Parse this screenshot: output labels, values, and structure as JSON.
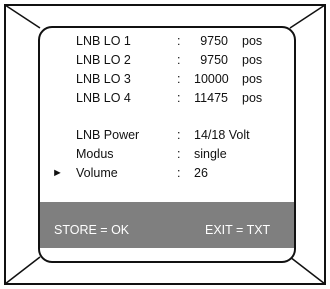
{
  "menu": {
    "rows": [
      {
        "label": "LNB LO 1",
        "colon": ":",
        "value": "9750",
        "unit": "pos"
      },
      {
        "label": "LNB LO 2",
        "colon": ":",
        "value": "9750",
        "unit": "pos"
      },
      {
        "label": "LNB LO 3",
        "colon": ":",
        "value": "10000",
        "unit": "pos"
      },
      {
        "label": "LNB LO 4",
        "colon": ":",
        "value": "11475",
        "unit": "pos"
      }
    ],
    "settings": [
      {
        "label": "LNB Power",
        "colon": ":",
        "value": "14/18 Volt"
      },
      {
        "label": "Modus",
        "colon": ":",
        "value": "single"
      },
      {
        "label": "Volume",
        "colon": ":",
        "value": "26"
      }
    ],
    "selected_marker": "►"
  },
  "footer": {
    "store": "STORE = OK",
    "exit": "EXIT = TXT"
  }
}
